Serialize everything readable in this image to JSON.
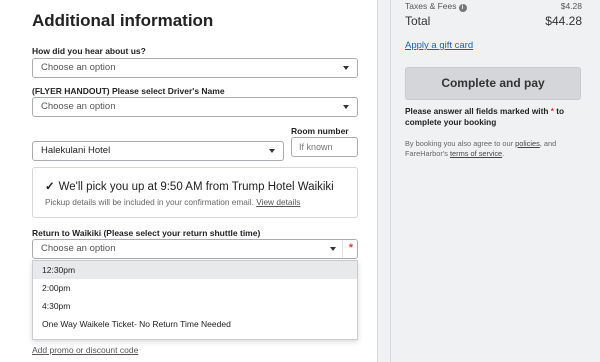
{
  "form": {
    "heading": "Additional information",
    "hear_about": {
      "label": "How did you hear about us?",
      "placeholder": "Choose an option"
    },
    "driver": {
      "label": "(FLYER HANDOUT) Please select Driver's Name",
      "placeholder": "Choose an option"
    },
    "hotel": {
      "value": "Halekulani Hotel"
    },
    "room": {
      "label": "Room number",
      "placeholder": "If known"
    },
    "pickup": {
      "check": "✓",
      "title": "We'll pick you up at 9:50 AM from Trump Hotel Waikiki",
      "subtitle": "Pickup details will be included in your confirmation email.",
      "details_link": "View details"
    },
    "return": {
      "label": "Return to Waikiki (Please select your return shuttle time)",
      "placeholder": "Choose an option",
      "required_mark": "*",
      "options": [
        "12:30pm",
        "2:00pm",
        "4:30pm",
        "One Way Waikele Ticket- No Return Time Needed"
      ]
    },
    "promo_link": "Add promo or discount code"
  },
  "summary": {
    "taxes_label": "Taxes & Fees",
    "taxes_info_icon": "i",
    "taxes_amount": "$4.28",
    "total_label": "Total",
    "total_amount": "$44.28",
    "gift_link": "Apply a gift card",
    "pay_button": "Complete and pay",
    "warning_before": "Please answer all fields marked with",
    "warning_star": "*",
    "warning_after": "to complete your booking",
    "terms_before": "By booking you also agree to our",
    "terms_policies": "policies",
    "terms_mid": ", and FareHarbor's",
    "terms_link": "terms of service",
    "terms_end": "."
  },
  "colors": {
    "link_blue": "#1b62b5",
    "required_red": "#e23b2e",
    "button_gray": "#d4d6d9"
  }
}
